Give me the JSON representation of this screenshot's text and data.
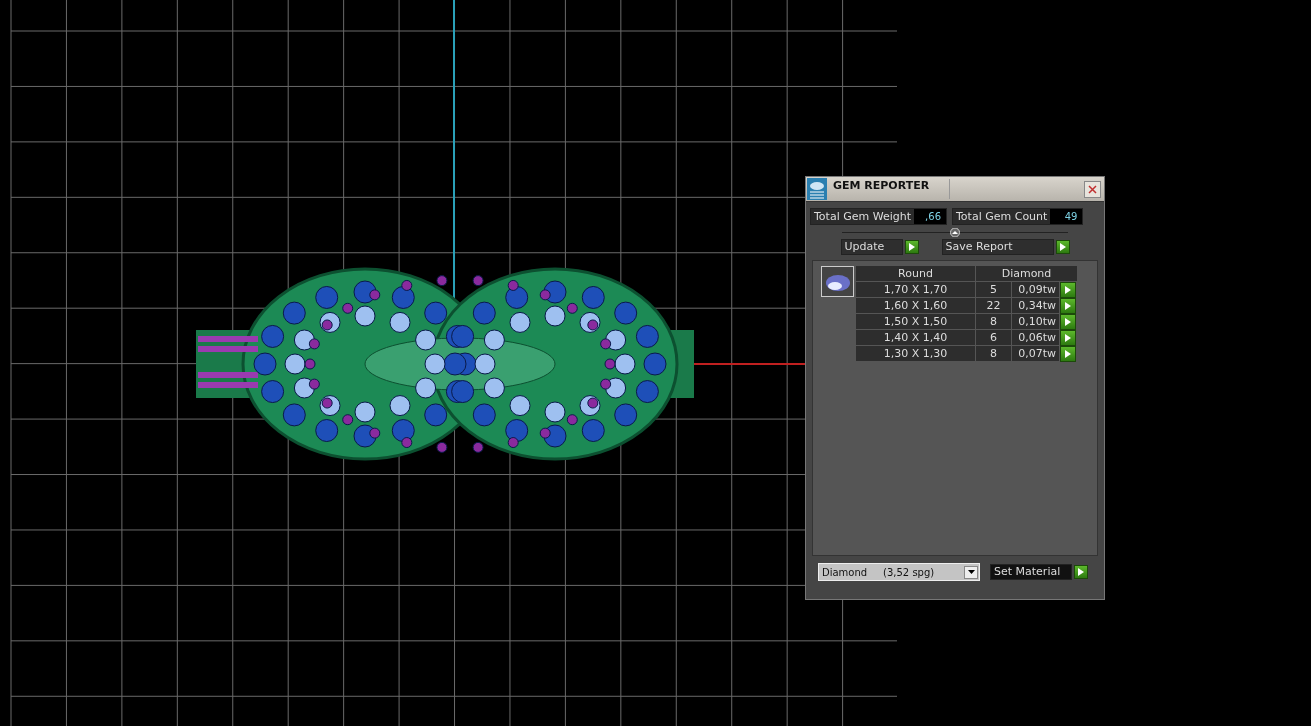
{
  "panel": {
    "title": "GEM REPORTER",
    "totals": [
      {
        "label": "Total Gem Weight",
        "value": ",66"
      },
      {
        "label": "Total Gem Count",
        "value": "49"
      }
    ],
    "actions": [
      {
        "label": "Update"
      },
      {
        "label": "Save Report"
      }
    ],
    "table": {
      "columns": [
        "Round",
        "Diamond"
      ],
      "rows": [
        {
          "size": "1,70 X 1,70",
          "count": "5",
          "weight": "0,09tw"
        },
        {
          "size": "1,60 X 1,60",
          "count": "22",
          "weight": "0,34tw"
        },
        {
          "size": "1,50 X 1,50",
          "count": "8",
          "weight": "0,10tw"
        },
        {
          "size": "1,40 X 1,40",
          "count": "6",
          "weight": "0,06tw"
        },
        {
          "size": "1,30 X 1,30",
          "count": "8",
          "weight": "0,07tw"
        }
      ]
    },
    "material": {
      "value": "Diamond     (3,52 spg)",
      "button": "Set Material"
    }
  }
}
